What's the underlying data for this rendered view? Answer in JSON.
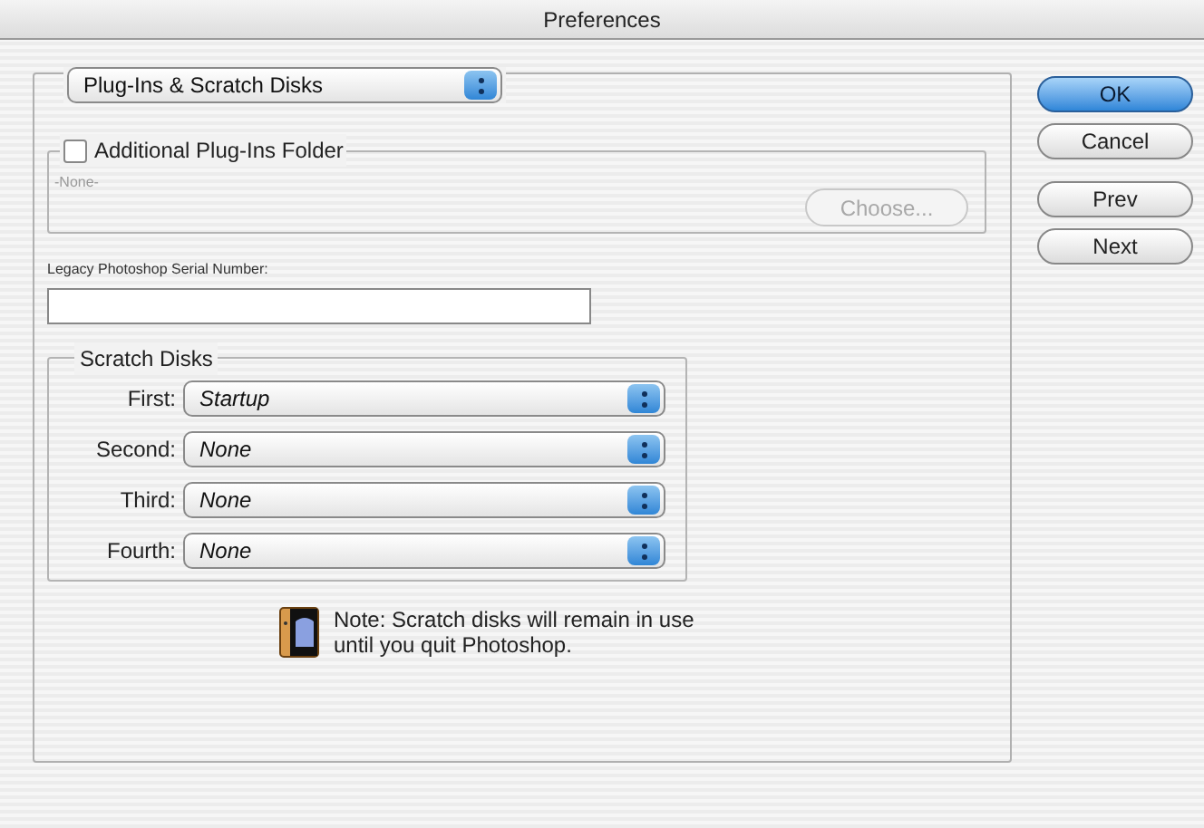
{
  "window": {
    "title": "Preferences"
  },
  "section_menu": {
    "value": "Plug-Ins & Scratch Disks"
  },
  "plugins_folder": {
    "label": "Additional Plug-Ins Folder",
    "checked": false,
    "path": "-None-",
    "choose_button": {
      "label": "Choose...",
      "disabled": true
    }
  },
  "serial": {
    "label": "Legacy Photoshop Serial Number:"
  },
  "scratch_disks": {
    "title": "Scratch Disks",
    "rows": [
      {
        "label": "First:",
        "value": "Startup"
      },
      {
        "label": "Second:",
        "value": "None"
      },
      {
        "label": "Third:",
        "value": "None"
      },
      {
        "label": "Fourth:",
        "value": "None"
      }
    ]
  },
  "note": "Note: Scratch disks will remain in use until you quit Photoshop.",
  "buttons": [
    {
      "label": "OK",
      "default": true
    },
    {
      "label": "Cancel",
      "default": false
    },
    {
      "label": "Prev",
      "default": false
    },
    {
      "label": "Next",
      "default": false
    }
  ]
}
